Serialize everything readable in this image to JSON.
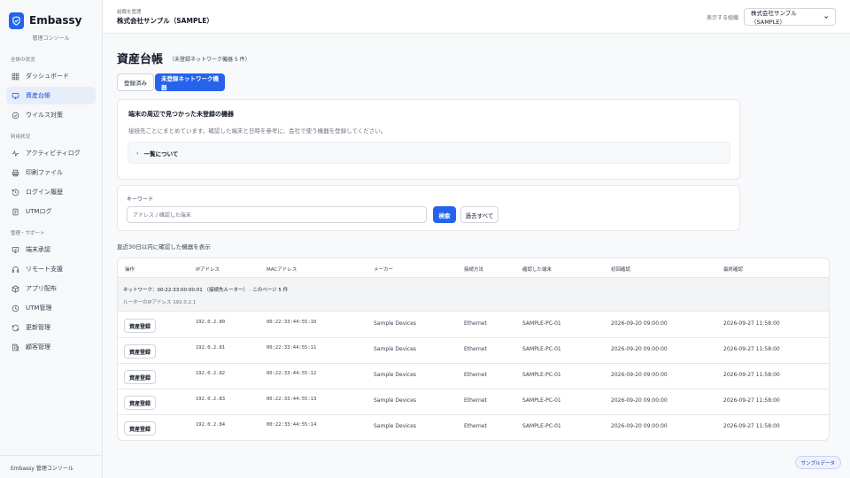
{
  "brand": {
    "name": "Embassy",
    "subtitle": "管理コンソール"
  },
  "sidebar": {
    "sections": [
      {
        "title": "全体の状況",
        "items": [
          {
            "label": "ダッシュボード",
            "icon": "grid-icon"
          },
          {
            "label": "資産台帳",
            "icon": "monitor-icon",
            "active": true
          },
          {
            "label": "ウイルス対策",
            "icon": "shield-check-icon"
          }
        ]
      },
      {
        "title": "利用状況",
        "items": [
          {
            "label": "アクティビティログ",
            "icon": "activity-icon"
          },
          {
            "label": "印刷ファイル",
            "icon": "printer-icon"
          },
          {
            "label": "ログイン履歴",
            "icon": "history-icon"
          },
          {
            "label": "UTMログ",
            "icon": "document-icon"
          }
        ]
      },
      {
        "title": "管理・サポート",
        "items": [
          {
            "label": "端末承認",
            "icon": "monitor-check-icon"
          },
          {
            "label": "リモート支援",
            "icon": "headset-icon"
          },
          {
            "label": "アプリ配布",
            "icon": "package-icon"
          },
          {
            "label": "UTM管理",
            "icon": "router-icon"
          },
          {
            "label": "更新管理",
            "icon": "refresh-icon"
          },
          {
            "label": "顧客管理",
            "icon": "building-icon"
          }
        ]
      }
    ],
    "footer": "Embassy 管理コンソール"
  },
  "topbar": {
    "org_label": "組織を管理",
    "org_name": "株式会社サンプル（SAMPLE）",
    "select_label": "表示する組織",
    "select_value": "株式会社サンプル（SAMPLE）"
  },
  "page": {
    "title": "資産台帳",
    "subtitle": "（未登録ネットワーク機器 5 件）",
    "tabs": [
      {
        "label": "登録済み",
        "active": false
      },
      {
        "label": "未登録ネットワーク機器",
        "active": true
      }
    ]
  },
  "info_card": {
    "title": "端末の周辺で見つかった未登録の機器",
    "description": "接続先ごとにまとめています。確認した端末と日時を参考に、会社で使う機器を登録してください。",
    "accordion_label": "一覧について"
  },
  "search": {
    "label": "キーワード",
    "placeholder": "アドレス / 確認した端末",
    "search_button": "検索",
    "past_button": "過去すべて"
  },
  "recent_note": "直近30日以内に確認した機器を表示",
  "table": {
    "columns": [
      "操作",
      "IPアドレス",
      "MACアドレス",
      "メーカー",
      "接続方法",
      "確認した端末",
      "初回確認",
      "最終確認"
    ],
    "group": {
      "line1": "ネットワーク：00:22:33:00:00:01 （接続先ルーター） · このページ 5 件",
      "line2": "ルーターのIPアドレス 192.0.2.1"
    },
    "register_label": "資産登録",
    "rows": [
      {
        "ip": "192.0.2.80",
        "mac": "00:22:33:44:55:10",
        "vendor": "Sample Devices",
        "conn": "Ethernet",
        "terminal": "SAMPLE-PC-01",
        "first": "2026-09-20 09:00:00",
        "last": "2026-09-27 11:58:00"
      },
      {
        "ip": "192.0.2.81",
        "mac": "00:22:33:44:55:11",
        "vendor": "Sample Devices",
        "conn": "Ethernet",
        "terminal": "SAMPLE-PC-01",
        "first": "2026-09-20 09:00:00",
        "last": "2026-09-27 11:58:00"
      },
      {
        "ip": "192.0.2.82",
        "mac": "00:22:33:44:55:12",
        "vendor": "Sample Devices",
        "conn": "Ethernet",
        "terminal": "SAMPLE-PC-01",
        "first": "2026-09-20 09:00:00",
        "last": "2026-09-27 11:58:00"
      },
      {
        "ip": "192.0.2.83",
        "mac": "00:22:33:44:55:13",
        "vendor": "Sample Devices",
        "conn": "Ethernet",
        "terminal": "SAMPLE-PC-01",
        "first": "2026-09-20 09:00:00",
        "last": "2026-09-27 11:58:00"
      },
      {
        "ip": "192.0.2.84",
        "mac": "00:22:33:44:55:14",
        "vendor": "Sample Devices",
        "conn": "Ethernet",
        "terminal": "SAMPLE-PC-01",
        "first": "2026-09-20 09:00:00",
        "last": "2026-09-27 11:58:00"
      }
    ]
  },
  "sample_badge": "サンプルデータ",
  "colors": {
    "accent": "#2563eb",
    "active_bg": "#e8eef9"
  }
}
